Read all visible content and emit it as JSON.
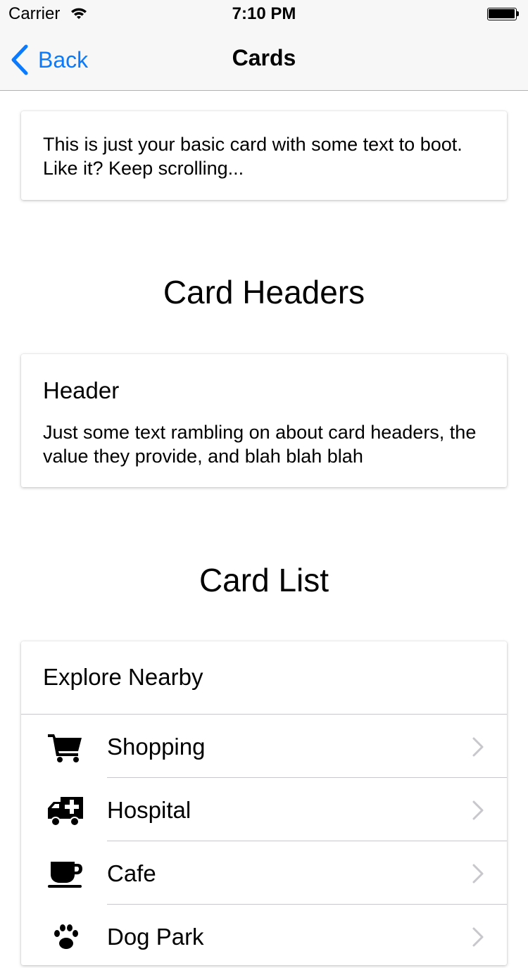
{
  "status_bar": {
    "carrier": "Carrier",
    "time": "7:10 PM"
  },
  "nav": {
    "back_label": "Back",
    "title": "Cards"
  },
  "basic_card": {
    "text": "This is just your basic card with some text to boot. Like it? Keep scrolling..."
  },
  "sections": {
    "card_headers": "Card Headers",
    "card_list": "Card List"
  },
  "header_card": {
    "header": "Header",
    "text": "Just some text rambling on about card headers, the value they provide, and blah blah blah"
  },
  "list_card": {
    "title": "Explore Nearby",
    "items": [
      {
        "label": "Shopping",
        "icon": "cart-icon"
      },
      {
        "label": "Hospital",
        "icon": "ambulance-icon"
      },
      {
        "label": "Cafe",
        "icon": "coffee-icon"
      },
      {
        "label": "Dog Park",
        "icon": "paw-icon"
      }
    ]
  },
  "colors": {
    "accent": "#0a7aff",
    "bar_background": "#f7f7f7",
    "separator": "#c8c7cc",
    "chevron": "#c7c7cc"
  }
}
